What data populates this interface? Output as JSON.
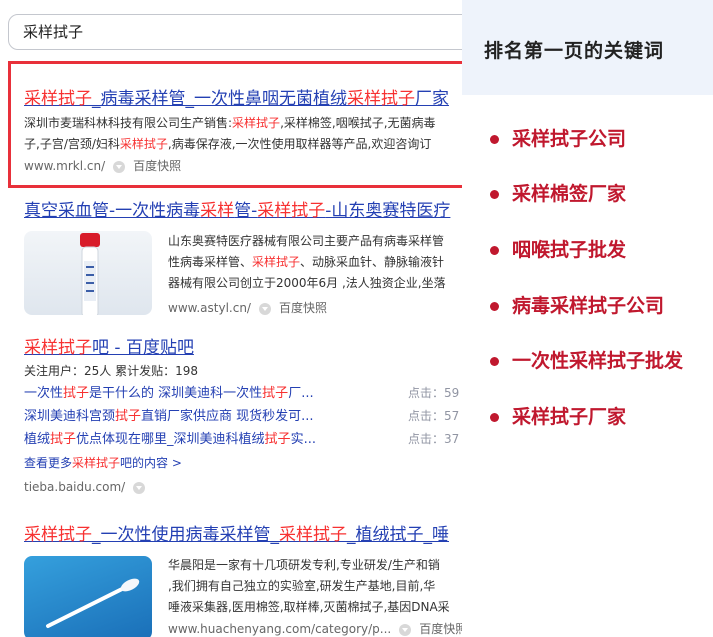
{
  "search": {
    "query": "采样拭子"
  },
  "results": [
    {
      "title": [
        "采样拭子",
        "_病毒采样管_一次性鼻咽无菌植绒",
        "采样拭子",
        "厂家"
      ],
      "snippet1": [
        "深圳市麦瑞科林科技有限公司生产销售:",
        "采样拭子",
        ",采样棉签,咽喉拭子,无菌病毒"
      ],
      "snippet2": [
        "子,子宫/宫颈/妇科",
        "采样拭子",
        ",病毒保存液,一次性使用取样器等产品,欢迎咨询订"
      ],
      "url": "www.mrkl.cn/",
      "snapshot": "百度快照"
    },
    {
      "title": [
        "真空采血管-一次性病毒",
        "采样",
        "管-",
        "采样拭子",
        "-山东奥赛特医疗"
      ],
      "snippet1": [
        "山东奥赛特医疗器械有限公司主要产品有病毒采样管"
      ],
      "snippet2": [
        "性病毒采样管、",
        "采样拭子",
        "、动脉采血针、静脉输液针"
      ],
      "snippet3": [
        "器械有限公司创立于2000年6月 ,法人独资企业,坐落"
      ],
      "url": "www.astyl.cn/",
      "snapshot": "百度快照"
    },
    {
      "title": [
        "采样拭子",
        "吧 - 百度贴吧"
      ],
      "meta": "关注用户：25人  累计发贴：198",
      "links": [
        {
          "parts": [
            "一次性",
            "拭子",
            "是干什么的 深圳美迪科一次性",
            "拭子",
            "厂..."
          ],
          "count": "点击：59"
        },
        {
          "parts": [
            "深圳美迪科宫颈",
            "拭子",
            "直销厂家供应商 现货秒发可..."
          ],
          "count": "点击：57"
        },
        {
          "parts": [
            "植绒",
            "拭子",
            "优点体现在哪里_深圳美迪科植绒",
            "拭子",
            "实..."
          ],
          "count": "点击：37"
        }
      ],
      "more": [
        "查看更多",
        "采样拭子",
        "吧的内容 >"
      ],
      "url": "tieba.baidu.com/"
    },
    {
      "title": [
        "采样拭子",
        "_一次性使用病毒采样管_",
        "采样拭子",
        "_植绒拭子_唾"
      ],
      "snippet1": [
        "华晨阳是一家有十几项研发专利,专业研发/生产和销"
      ],
      "snippet2": [
        ",我们拥有自己独立的实验室,研发生产基地,目前,华"
      ],
      "snippet3": [
        "唾液采集器,医用棉签,取样棒,灭菌棉拭子,基因DNA采"
      ],
      "url": "www.huachenyang.com/category/p...",
      "snapshot": "百度快照"
    }
  ],
  "sidebar": {
    "heading": "排名第一页的关键词",
    "keywords": [
      "采样拭子公司",
      "采样棉签厂家",
      "咽喉拭子批发",
      "病毒采样拭子公司",
      "一次性采样拭子批发",
      "采样拭子厂家"
    ],
    "accent_color": "#c0182e",
    "header_bg": "#eef3fb"
  },
  "highlight_color": "#f73131",
  "link_color": "#2440b3"
}
